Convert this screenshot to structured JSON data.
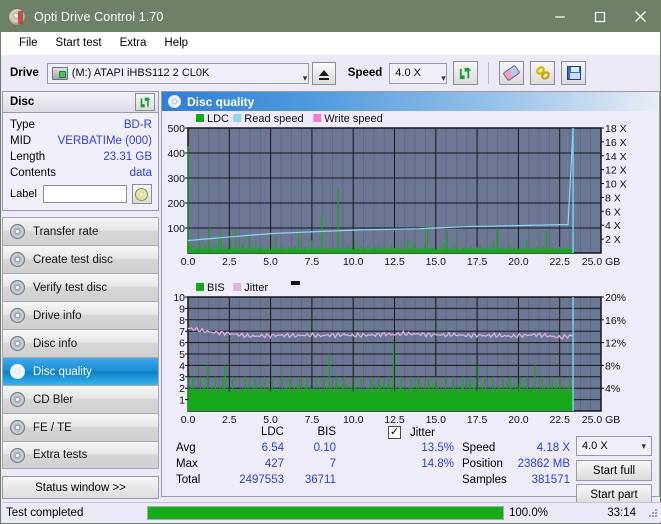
{
  "window": {
    "title": "Opti Drive Control 1.70",
    "icon": "disc-icon",
    "minimize": "minimize-icon",
    "maximize": "maximize-icon",
    "close": "close-icon"
  },
  "menu": {
    "items": [
      "File",
      "Start test",
      "Extra",
      "Help"
    ]
  },
  "toolbar": {
    "drive_label": "Drive",
    "drive_value": "(M:) ATAPI iHBS112  2 CL0K",
    "eject_icon": "eject-icon",
    "speed_label": "Speed",
    "speed_value": "4.0 X",
    "refresh_icon": "refresh-icon",
    "eraser_icon": "eraser-icon",
    "chain_icon": "chain-icon",
    "save_icon": "save-icon"
  },
  "disc": {
    "header": "Disc",
    "refresh_icon": "refresh-icon",
    "rows": [
      {
        "key": "Type",
        "value": "BD-R"
      },
      {
        "key": "MID",
        "value": "VERBATIMe (000)"
      },
      {
        "key": "Length",
        "value": "23.31 GB"
      },
      {
        "key": "Contents",
        "value": "data"
      }
    ],
    "label_key": "Label",
    "label_value": "",
    "label_placeholder": "",
    "disc_button_icon": "cd-icon"
  },
  "nav": {
    "items": [
      {
        "label": "Transfer rate",
        "active": false
      },
      {
        "label": "Create test disc",
        "active": false
      },
      {
        "label": "Verify test disc",
        "active": false
      },
      {
        "label": "Drive info",
        "active": false
      },
      {
        "label": "Disc info",
        "active": false
      },
      {
        "label": "Disc quality",
        "active": true
      },
      {
        "label": "CD Bler",
        "active": false
      },
      {
        "label": "FE / TE",
        "active": false
      },
      {
        "label": "Extra tests",
        "active": false
      }
    ],
    "status_window": "Status window >>"
  },
  "content": {
    "title": "Disc quality",
    "icon": "disc-quality-icon"
  },
  "stats": {
    "col_ldc": "LDC",
    "col_bis": "BIS",
    "jitter_label": "Jitter",
    "jitter_checked": true,
    "rows": [
      {
        "name": "Avg",
        "ldc": "6.54",
        "bis": "0.10",
        "jitter": "13.5%"
      },
      {
        "name": "Max",
        "ldc": "427",
        "bis": "7",
        "jitter": "14.8%"
      },
      {
        "name": "Total",
        "ldc": "2497553",
        "bis": "36711",
        "jitter": ""
      }
    ],
    "speed_label": "Speed",
    "speed_value": "4.18 X",
    "position_label": "Position",
    "position_value": "23862 MB",
    "samples_label": "Samples",
    "samples_value": "381571",
    "speed_select": "4.0 X",
    "start_full": "Start full",
    "start_part": "Start part"
  },
  "statusbar": {
    "text": "Test completed",
    "percent_label": "100.0%",
    "percent_value": 100,
    "time": "33:14"
  },
  "chart_data": [
    {
      "type": "area",
      "id": "ldc-chart",
      "title": "",
      "xlabel": "GB",
      "ylabel": "",
      "xlim": [
        0,
        25
      ],
      "ylim": [
        0,
        500
      ],
      "xticks": [
        "0.0",
        "2.5",
        "5.0",
        "7.5",
        "10.0",
        "12.5",
        "15.0",
        "17.5",
        "20.0",
        "22.5",
        "25.0 GB"
      ],
      "yticks": [
        "100",
        "200",
        "300",
        "400",
        "500"
      ],
      "y2lim": [
        0,
        18
      ],
      "y2ticks": [
        "2 X",
        "4 X",
        "6 X",
        "8 X",
        "10 X",
        "12 X",
        "14 X",
        "16 X",
        "18 X"
      ],
      "grid": true,
      "legend": [
        {
          "name": "LDC",
          "color": "#17a81a"
        },
        {
          "name": "Read speed",
          "color": "#8fd6f5"
        },
        {
          "name": "Write speed",
          "color": "#f57ad4"
        }
      ],
      "data_end_gb": 23.31,
      "series": [
        {
          "name": "LDC",
          "color": "#17a81a",
          "kind": "spikes",
          "baseline": 14,
          "x": [
            0.0,
            0.1,
            0.2,
            0.35,
            0.5,
            0.7,
            0.9,
            1.1,
            1.3,
            1.5,
            1.7,
            1.85,
            2.0,
            2.2,
            2.4,
            2.55,
            2.7,
            2.9,
            3.1,
            3.3,
            3.5,
            3.7,
            3.9,
            4.1,
            4.3,
            4.5,
            4.7,
            4.9,
            5.1,
            5.3,
            5.5,
            5.7,
            5.9,
            6.1,
            6.3,
            6.5,
            6.7,
            6.9,
            7.1,
            7.3,
            7.5,
            7.7,
            7.9,
            8.1,
            8.3,
            8.5,
            8.7,
            8.9,
            9.1,
            9.3,
            9.5,
            9.7,
            9.9,
            10.1,
            10.3,
            10.5,
            10.7,
            10.9,
            11.1,
            11.3,
            11.5,
            11.7,
            11.9,
            12.1,
            12.3,
            12.5,
            12.7,
            12.9,
            13.1,
            13.3,
            13.5,
            13.7,
            13.9,
            14.1,
            14.3,
            14.5,
            14.7,
            14.9,
            15.1,
            15.3,
            15.5,
            15.7,
            15.9,
            16.1,
            16.3,
            16.5,
            16.7,
            16.9,
            17.1,
            17.3,
            17.5,
            17.7,
            17.9,
            18.1,
            18.3,
            18.5,
            18.7,
            18.9,
            19.1,
            19.3,
            19.5,
            19.7,
            19.9,
            20.1,
            20.3,
            20.5,
            20.7,
            20.9,
            21.1,
            21.3,
            21.5,
            21.7,
            21.9,
            22.1,
            22.3,
            22.5,
            22.7,
            22.9,
            23.1,
            23.3
          ],
          "y": [
            427,
            40,
            30,
            26,
            22,
            55,
            20,
            38,
            100,
            24,
            30,
            62,
            84,
            26,
            22,
            58,
            20,
            95,
            30,
            40,
            20,
            70,
            18,
            48,
            22,
            30,
            18,
            26,
            20,
            60,
            18,
            30,
            20,
            22,
            18,
            28,
            90,
            20,
            26,
            18,
            50,
            20,
            30,
            155,
            22,
            18,
            26,
            20,
            255,
            22,
            18,
            30,
            22,
            55,
            18,
            26,
            20,
            30,
            18,
            22,
            28,
            20,
            26,
            18,
            32,
            20,
            24,
            18,
            20,
            52,
            18,
            40,
            22,
            18,
            30,
            110,
            20,
            26,
            18,
            22,
            44,
            80,
            18,
            30,
            22,
            18,
            26,
            20,
            30,
            18,
            22,
            28,
            20,
            24,
            18,
            45,
            100,
            20,
            26,
            18,
            30,
            22,
            18,
            26,
            20,
            50,
            18,
            22,
            30,
            18,
            26,
            90,
            20,
            22,
            18,
            26,
            20,
            18,
            22,
            18
          ]
        },
        {
          "name": "Read speed",
          "color": "#8fd6f5",
          "kind": "line",
          "axis": "right",
          "x": [
            0.0,
            1.0,
            2.0,
            3.0,
            4.0,
            5.0,
            6.0,
            7.0,
            8.0,
            9.0,
            10.0,
            11.0,
            12.0,
            13.0,
            14.0,
            15.0,
            16.0,
            17.0,
            18.0,
            19.0,
            20.0,
            21.0,
            22.0,
            23.0,
            23.31
          ],
          "y": [
            1.8,
            2.0,
            2.2,
            2.4,
            2.6,
            2.8,
            2.9,
            3.0,
            3.1,
            3.2,
            3.3,
            3.35,
            3.4,
            3.45,
            3.5,
            3.6,
            3.7,
            3.8,
            3.85,
            3.9,
            3.95,
            4.0,
            4.05,
            4.1,
            18.0
          ]
        }
      ]
    },
    {
      "type": "area",
      "id": "bis-chart",
      "title": "",
      "xlabel": "GB",
      "ylabel": "",
      "xlim": [
        0,
        25
      ],
      "ylim": [
        0,
        10
      ],
      "xticks": [
        "0.0",
        "2.5",
        "5.0",
        "7.5",
        "10.0",
        "12.5",
        "15.0",
        "17.5",
        "20.0",
        "22.5",
        "25.0 GB"
      ],
      "yticks": [
        "1",
        "2",
        "3",
        "4",
        "5",
        "6",
        "7",
        "8",
        "9",
        "10"
      ],
      "y2lim": [
        0,
        20
      ],
      "y2ticks": [
        "4%",
        "8%",
        "12%",
        "16%",
        "20%"
      ],
      "grid": true,
      "legend": [
        {
          "name": "BIS",
          "color": "#17a81a"
        },
        {
          "name": "Jitter",
          "color": "#e3b3e0"
        }
      ],
      "data_end_gb": 23.31,
      "series": [
        {
          "name": "BIS",
          "color": "#17a81a",
          "kind": "spikes",
          "baseline": 1.7,
          "x": [
            0.0,
            0.15,
            0.3,
            0.45,
            0.6,
            0.75,
            0.9,
            1.05,
            1.2,
            1.35,
            1.5,
            1.65,
            1.8,
            1.95,
            2.1,
            2.25,
            2.4,
            2.55,
            2.7,
            2.85,
            3.0,
            3.15,
            3.3,
            3.45,
            3.6,
            3.75,
            3.9,
            4.05,
            4.2,
            4.35,
            4.5,
            4.65,
            4.8,
            4.95,
            5.1,
            5.25,
            5.4,
            5.55,
            5.7,
            5.85,
            6.0,
            6.15,
            6.3,
            6.45,
            6.6,
            6.75,
            6.9,
            7.05,
            7.2,
            7.35,
            7.5,
            7.65,
            7.8,
            7.95,
            8.1,
            8.25,
            8.4,
            8.55,
            8.7,
            8.85,
            9.0,
            9.15,
            9.3,
            9.45,
            9.6,
            9.75,
            9.9,
            10.05,
            10.2,
            10.35,
            10.5,
            10.65,
            10.8,
            10.95,
            11.1,
            11.25,
            11.4,
            11.55,
            11.7,
            11.85,
            12.0,
            12.15,
            12.3,
            12.45,
            12.6,
            12.75,
            12.9,
            13.05,
            13.2,
            13.35,
            13.5,
            13.65,
            13.8,
            13.95,
            14.1,
            14.25,
            14.4,
            14.55,
            14.7,
            14.85,
            15.0,
            15.15,
            15.3,
            15.45,
            15.6,
            15.75,
            15.9,
            16.05,
            16.2,
            16.35,
            16.5,
            16.65,
            16.8,
            16.95,
            17.1,
            17.25,
            17.4,
            17.55,
            17.7,
            17.85,
            18.0,
            18.15,
            18.3,
            18.45,
            18.6,
            18.75,
            18.9,
            19.05,
            19.2,
            19.35,
            19.5,
            19.65,
            19.8,
            19.95,
            20.1,
            20.25,
            20.4,
            20.55,
            20.7,
            20.85,
            21.0,
            21.15,
            21.3,
            21.45,
            21.6,
            21.75,
            21.9,
            22.05,
            22.2,
            22.35,
            22.5,
            22.65,
            22.8,
            22.95,
            23.1,
            23.25
          ],
          "y": [
            3,
            2,
            3,
            2,
            2,
            3,
            2,
            2,
            4,
            2,
            2,
            3,
            2,
            2,
            3,
            4,
            2,
            2,
            3,
            2,
            1,
            2,
            2,
            3,
            2,
            2,
            2,
            3,
            2,
            2,
            2,
            3,
            2,
            2,
            3,
            2,
            2,
            2,
            3,
            2,
            2,
            3,
            2,
            2,
            2,
            3,
            2,
            2,
            3,
            2,
            2,
            2,
            3,
            2,
            2,
            3,
            2,
            5,
            2,
            2,
            3,
            2,
            2,
            3,
            2,
            2,
            2,
            3,
            2,
            2,
            3,
            2,
            2,
            2,
            3,
            2,
            2,
            3,
            2,
            2,
            2,
            3,
            2,
            6,
            2,
            2,
            3,
            2,
            2,
            2,
            3,
            2,
            2,
            3,
            2,
            2,
            2,
            3,
            2,
            2,
            3,
            2,
            2,
            2,
            3,
            2,
            2,
            3,
            2,
            2,
            2,
            3,
            2,
            2,
            3,
            2,
            2,
            4,
            2,
            2,
            3,
            2,
            2,
            3,
            2,
            2,
            2,
            3,
            2,
            2,
            3,
            2,
            2,
            2,
            3,
            2,
            2,
            3,
            2,
            2,
            4,
            2,
            2,
            3,
            2,
            2,
            2,
            3,
            2,
            2,
            3,
            2,
            2,
            2,
            3,
            2,
            2,
            2
          ]
        },
        {
          "name": "Jitter",
          "color": "#e3b3e0",
          "kind": "line",
          "axis": "right",
          "x": [
            0.0,
            0.5,
            1.0,
            1.5,
            2.0,
            2.5,
            3.0,
            3.5,
            4.0,
            4.5,
            5.0,
            5.5,
            6.0,
            6.5,
            7.0,
            7.5,
            8.0,
            8.5,
            9.0,
            9.5,
            10.0,
            10.5,
            11.0,
            11.5,
            12.0,
            12.5,
            13.0,
            13.5,
            14.0,
            14.5,
            15.0,
            15.5,
            16.0,
            16.5,
            17.0,
            17.5,
            18.0,
            18.5,
            19.0,
            19.5,
            20.0,
            20.5,
            21.0,
            21.5,
            22.0,
            22.5,
            23.0,
            23.31
          ],
          "y": [
            14.5,
            14.3,
            14.0,
            13.8,
            13.7,
            13.6,
            13.4,
            13.2,
            13.1,
            13.2,
            13.2,
            13.3,
            13.3,
            13.2,
            13.3,
            13.3,
            13.2,
            13.3,
            13.3,
            13.4,
            13.2,
            13.3,
            13.3,
            13.4,
            13.5,
            13.4,
            13.6,
            13.5,
            13.5,
            13.4,
            13.4,
            13.3,
            13.4,
            13.3,
            13.2,
            13.3,
            13.2,
            13.3,
            13.2,
            13.1,
            13.2,
            13.3,
            13.4,
            13.3,
            13.1,
            12.9,
            13.1,
            13.2
          ]
        }
      ]
    }
  ]
}
